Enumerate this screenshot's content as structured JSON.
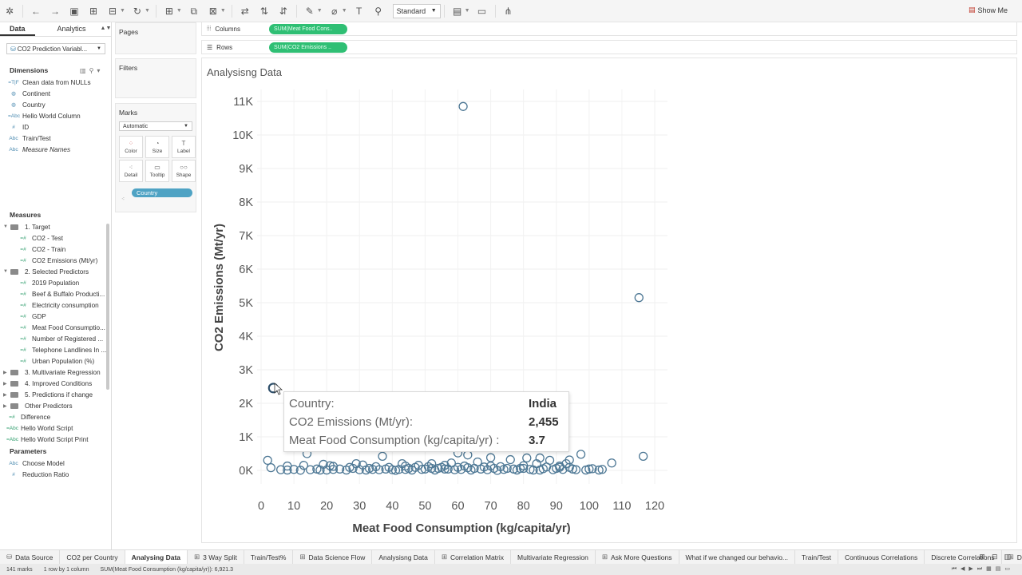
{
  "toolbar": {
    "fit": "Standard",
    "show_me": "Show Me"
  },
  "data_pane": {
    "tabs": [
      "Data",
      "Analytics"
    ],
    "datasource": "CO2 Prediction Variabl...",
    "dimensions_title": "Dimensions",
    "dimensions": [
      {
        "icon": "=T|F",
        "label": "Clean data from NULLs",
        "italic": false
      },
      {
        "icon": "globe",
        "label": "Continent",
        "italic": false
      },
      {
        "icon": "globe",
        "label": "Country",
        "italic": false
      },
      {
        "icon": "=Abc",
        "label": "Hello World Column",
        "italic": false
      },
      {
        "icon": "#",
        "label": "ID",
        "italic": false
      },
      {
        "icon": "Abc",
        "label": "Train/Test",
        "italic": false
      },
      {
        "icon": "Abc",
        "label": "Measure Names",
        "italic": true
      }
    ],
    "measures_title": "Measures",
    "measures": [
      {
        "level": 0,
        "folder": true,
        "label": "1. Target",
        "open": true
      },
      {
        "level": 1,
        "folder": false,
        "label": "CO2 - Test"
      },
      {
        "level": 1,
        "folder": false,
        "label": "CO2 - Train"
      },
      {
        "level": 1,
        "folder": false,
        "label": "CO2 Emissions (Mt/yr)"
      },
      {
        "level": 0,
        "folder": true,
        "label": "2. Selected Predictors",
        "open": true
      },
      {
        "level": 1,
        "folder": false,
        "label": "2019 Population"
      },
      {
        "level": 1,
        "folder": false,
        "label": "Beef & Buffalo Producti..."
      },
      {
        "level": 1,
        "folder": false,
        "label": "Electricity consumption"
      },
      {
        "level": 1,
        "folder": false,
        "label": "GDP"
      },
      {
        "level": 1,
        "folder": false,
        "label": "Meat Food Consumptio..."
      },
      {
        "level": 1,
        "folder": false,
        "label": "Number of Registered ..."
      },
      {
        "level": 1,
        "folder": false,
        "label": "Telephone Landlines In ..."
      },
      {
        "level": 1,
        "folder": false,
        "label": "Urban Population (%)"
      },
      {
        "level": 0,
        "folder": true,
        "label": "3. Multivariate Regression",
        "open": false
      },
      {
        "level": 0,
        "folder": true,
        "label": "4. Improved Conditions",
        "open": false
      },
      {
        "level": 0,
        "folder": true,
        "label": "5. Predictions if change",
        "open": false
      },
      {
        "level": 0,
        "folder": true,
        "label": "Other Predictors",
        "open": false
      },
      {
        "level": 0,
        "folder": false,
        "label": "Difference",
        "icon": "=#"
      },
      {
        "level": 0,
        "folder": false,
        "label": "Hello World Script",
        "icon": "=Abc"
      },
      {
        "level": 0,
        "folder": false,
        "label": "Hello World Script Print",
        "icon": "=Abc"
      }
    ],
    "parameters_title": "Parameters",
    "parameters": [
      {
        "icon": "Abc",
        "label": "Choose Model"
      },
      {
        "icon": "#",
        "label": "Reduction Ratio"
      }
    ]
  },
  "cards": {
    "pages": "Pages",
    "filters": "Filters",
    "marks": "Marks",
    "mark_type": "Automatic",
    "mark_buttons": [
      "Color",
      "Size",
      "Label",
      "Detail",
      "Tooltip",
      "Shape"
    ],
    "detail_pill": "Country"
  },
  "shelves": {
    "columns_label": "Columns",
    "columns_pill": "SUM(Meat Food Cons..",
    "rows_label": "Rows",
    "rows_pill": "SUM(CO2 Emissions .."
  },
  "sheet_title": "Analysisng Data",
  "chart_data": {
    "type": "scatter",
    "xlabel": "Meat Food Consumption (kg/capita/yr)",
    "ylabel": "CO2 Emissions (Mt/yr)",
    "xlim": [
      0,
      125
    ],
    "ylim": [
      -250,
      11400
    ],
    "x_ticks": [
      0,
      10,
      20,
      30,
      40,
      50,
      60,
      70,
      80,
      90,
      100,
      110,
      120
    ],
    "x_tick_labels": [
      "0",
      "10",
      "20",
      "30",
      "40",
      "50",
      "60",
      "70",
      "80",
      "90",
      "100",
      "110",
      "120"
    ],
    "y_ticks": [
      0,
      1000,
      2000,
      3000,
      4000,
      5000,
      6000,
      7000,
      8000,
      9000,
      10000,
      11000
    ],
    "y_tick_labels": [
      "0K",
      "1K",
      "2K",
      "3K",
      "4K",
      "5K",
      "6K",
      "7K",
      "8K",
      "9K",
      "10K",
      "11K"
    ],
    "grid": true,
    "point_color": "#4e7895",
    "points": [
      [
        61.6,
        10850
      ],
      [
        115.2,
        5150
      ],
      [
        3.7,
        2455
      ],
      [
        116.5,
        420
      ],
      [
        97.5,
        480
      ],
      [
        106.9,
        220
      ],
      [
        3.0,
        80
      ],
      [
        6,
        20
      ],
      [
        8,
        10
      ],
      [
        10,
        30
      ],
      [
        12,
        5
      ],
      [
        13,
        150
      ],
      [
        15,
        20
      ],
      [
        17,
        40
      ],
      [
        18,
        10
      ],
      [
        19,
        180
      ],
      [
        20,
        10
      ],
      [
        21,
        140
      ],
      [
        22,
        30
      ],
      [
        24,
        40
      ],
      [
        26,
        10
      ],
      [
        28,
        60
      ],
      [
        29,
        200
      ],
      [
        30,
        20
      ],
      [
        31,
        160
      ],
      [
        32,
        10
      ],
      [
        33,
        60
      ],
      [
        34,
        30
      ],
      [
        35,
        110
      ],
      [
        36,
        20
      ],
      [
        38,
        40
      ],
      [
        39,
        90
      ],
      [
        40,
        20
      ],
      [
        41,
        0
      ],
      [
        42,
        30
      ],
      [
        43,
        200
      ],
      [
        44,
        130
      ],
      [
        45,
        60
      ],
      [
        46,
        10
      ],
      [
        47,
        90
      ],
      [
        48,
        150
      ],
      [
        49,
        30
      ],
      [
        50,
        40
      ],
      [
        51,
        110
      ],
      [
        52,
        200
      ],
      [
        53,
        10
      ],
      [
        54,
        60
      ],
      [
        55,
        90
      ],
      [
        56,
        150
      ],
      [
        57,
        40
      ],
      [
        58,
        220
      ],
      [
        59,
        20
      ],
      [
        60,
        90
      ],
      [
        61,
        30
      ],
      [
        62,
        130
      ],
      [
        63,
        80
      ],
      [
        64,
        10
      ],
      [
        65,
        60
      ],
      [
        66,
        250
      ],
      [
        67,
        40
      ],
      [
        68,
        100
      ],
      [
        69,
        20
      ],
      [
        70,
        130
      ],
      [
        71,
        60
      ],
      [
        72,
        0
      ],
      [
        74,
        30
      ],
      [
        75,
        60
      ],
      [
        76,
        320
      ],
      [
        77,
        40
      ],
      [
        78,
        10
      ],
      [
        79,
        60
      ],
      [
        80,
        140
      ],
      [
        81,
        370
      ],
      [
        82,
        30
      ],
      [
        83,
        10
      ],
      [
        84,
        200
      ],
      [
        85,
        370
      ],
      [
        86,
        50
      ],
      [
        87,
        100
      ],
      [
        88,
        300
      ],
      [
        89,
        20
      ],
      [
        90,
        60
      ],
      [
        91,
        130
      ],
      [
        92,
        30
      ],
      [
        93,
        200
      ],
      [
        94,
        90
      ],
      [
        95,
        40
      ],
      [
        96,
        20
      ],
      [
        99,
        10
      ],
      [
        101,
        50
      ],
      [
        103,
        10
      ],
      [
        104,
        30
      ],
      [
        2,
        300
      ],
      [
        8,
        130
      ],
      [
        14,
        500
      ],
      [
        22,
        120
      ],
      [
        27,
        90
      ],
      [
        37,
        420
      ],
      [
        44,
        30
      ],
      [
        52,
        60
      ],
      [
        56,
        40
      ],
      [
        60,
        520
      ],
      [
        63,
        460
      ],
      [
        70,
        380
      ],
      [
        73,
        110
      ],
      [
        80,
        60
      ],
      [
        85,
        10
      ],
      [
        91,
        90
      ],
      [
        94,
        310
      ],
      [
        100,
        40
      ]
    ]
  },
  "tooltip": {
    "rows": [
      {
        "label": "Country:",
        "value": "India"
      },
      {
        "label": "CO2 Emissions (Mt/yr):",
        "value": "2,455"
      },
      {
        "label": "Meat Food Consumption (kg/capita/yr) :",
        "value": "3.7"
      }
    ]
  },
  "sheet_tabs": [
    {
      "label": "Data Source",
      "active": false,
      "icon": "db"
    },
    {
      "label": "CO2 per Country",
      "active": false,
      "icon": ""
    },
    {
      "label": "Analysing Data",
      "active": true,
      "icon": ""
    },
    {
      "label": "3 Way Split",
      "active": false,
      "icon": "dash"
    },
    {
      "label": "Train/Test%",
      "active": false,
      "icon": ""
    },
    {
      "label": "Data Science Flow",
      "active": false,
      "icon": "dash"
    },
    {
      "label": "Analysisng Data",
      "active": false,
      "icon": ""
    },
    {
      "label": "Correlation Matrix",
      "active": false,
      "icon": "dash"
    },
    {
      "label": "Multivariate Regression",
      "active": false,
      "icon": ""
    },
    {
      "label": "Ask More Questions",
      "active": false,
      "icon": "dash"
    },
    {
      "label": "What if we changed our behavio...",
      "active": false,
      "icon": ""
    },
    {
      "label": "Train/Test",
      "active": false,
      "icon": ""
    },
    {
      "label": "Continuous Correlations",
      "active": false,
      "icon": ""
    },
    {
      "label": "Discrete Correlations",
      "active": false,
      "icon": ""
    },
    {
      "label": "Data Sc",
      "active": false,
      "icon": "dash"
    }
  ],
  "status": {
    "marks": "141 marks",
    "dims": "1 row by 1 column",
    "sum": "SUM(Meat Food Consumption (kg/capita/yr)): 6,921.3"
  }
}
